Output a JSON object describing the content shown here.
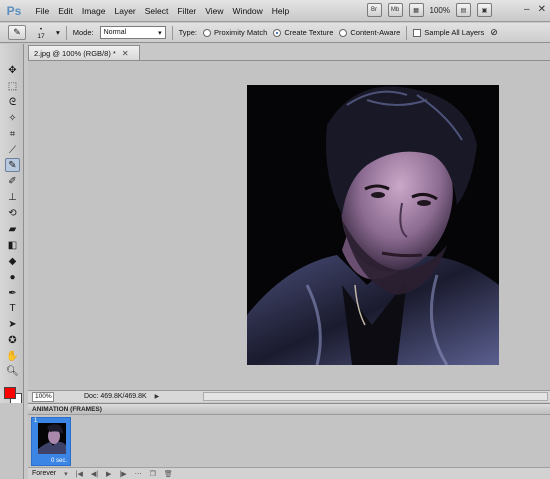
{
  "app": {
    "logo": "Ps",
    "menu": [
      "File",
      "Edit",
      "Image",
      "Layer",
      "Select",
      "Filter",
      "View",
      "Window",
      "Help"
    ],
    "toolbar_right": {
      "bridge_label": "Br",
      "minibridge_label": "Mb",
      "zoom": "100%"
    }
  },
  "options_bar": {
    "brush_size": "17",
    "mode_label": "Mode:",
    "mode_value": "Normal",
    "type_label": "Type:",
    "type_options": [
      "Proximity Match",
      "Create Texture",
      "Content-Aware"
    ],
    "type_selected": "Create Texture",
    "sample_all_layers": "Sample All Layers"
  },
  "document": {
    "tab_title": "2.jpg @ 100% (RGB/8) *",
    "zoom": "100%",
    "doc_info": "Doc: 469.8K/469.8K"
  },
  "colors": {
    "foreground": "#ff0000",
    "background": "#ffffff",
    "accent": "#3b86e4"
  },
  "animation": {
    "panel_title": "ANIMATION (FRAMES)",
    "frame_number": "1",
    "frame_delay": "0 sec.",
    "loop": "Forever"
  },
  "icons": [
    "move-icon",
    "marquee-icon",
    "lasso-icon",
    "quick-select-icon",
    "crop-icon",
    "eyedropper-icon",
    "spot-healing-icon",
    "brush-icon",
    "clone-stamp-icon",
    "history-brush-icon",
    "eraser-icon",
    "gradient-icon",
    "blur-icon",
    "dodge-icon",
    "pen-icon",
    "type-icon",
    "path-select-icon",
    "shape-icon",
    "hand-icon",
    "zoom-icon"
  ]
}
